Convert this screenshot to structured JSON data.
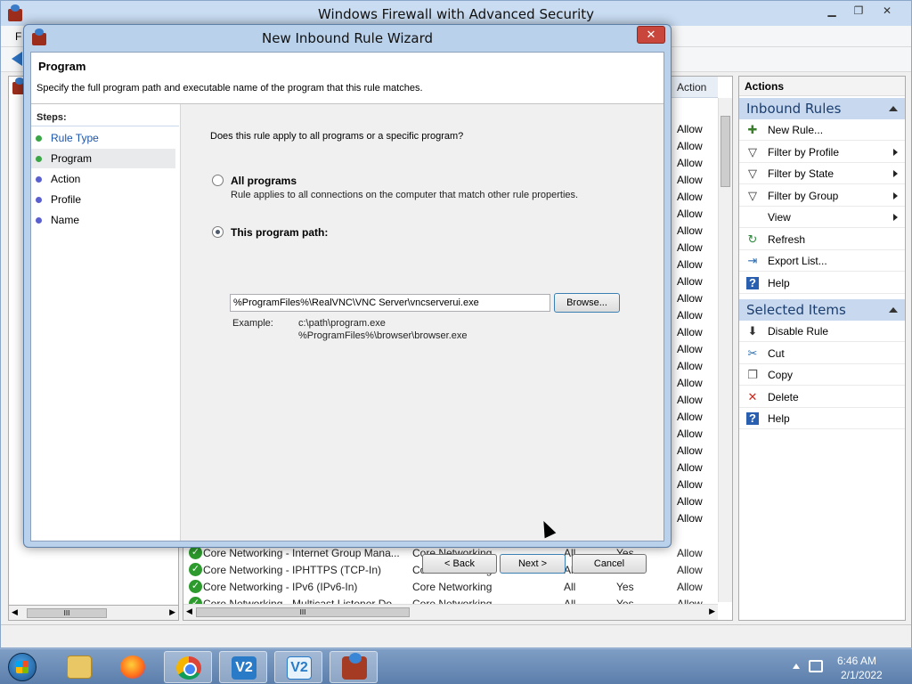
{
  "main": {
    "title": "Windows Firewall with Advanced Security",
    "menu_first_letter": "F",
    "list_headers": {
      "action": "Action"
    },
    "partial_action_values": [
      "Allow",
      "Allow",
      "Allow",
      "Allow",
      "Allow",
      "Allow",
      "Allow",
      "Allow",
      "Allow",
      "Allow",
      "Allow",
      "Allow",
      "Allow",
      "Allow",
      "Allow",
      "Allow",
      "Allow",
      "Allow",
      "Allow",
      "Allow",
      "Allow",
      "Allow",
      "Allow",
      "Allow"
    ],
    "visible_rows": [
      {
        "name": "Core Networking - Internet Group Mana...",
        "group": "Core Networking",
        "profile": "All",
        "enabled": "Yes",
        "action": "Allow"
      },
      {
        "name": "Core Networking - IPHTTPS (TCP-In)",
        "group": "Core Networking",
        "profile": "All",
        "enabled": "Yes",
        "action": "Allow"
      },
      {
        "name": "Core Networking - IPv6 (IPv6-In)",
        "group": "Core Networking",
        "profile": "All",
        "enabled": "Yes",
        "action": "Allow"
      },
      {
        "name": "Core Networking - Multicast Listener Do...",
        "group": "Core Networking",
        "profile": "All",
        "enabled": "Yes",
        "action": "Allow"
      }
    ],
    "tree_scroll_mark": "III",
    "list_scroll_mark": "III"
  },
  "actions": {
    "title": "Actions",
    "section1": "Inbound Rules",
    "section1_items": [
      {
        "label": "New Rule...",
        "icon": "new-rule-icon",
        "submenu": false
      },
      {
        "label": "Filter by Profile",
        "icon": "filter-icon",
        "submenu": true
      },
      {
        "label": "Filter by State",
        "icon": "filter-icon",
        "submenu": true
      },
      {
        "label": "Filter by Group",
        "icon": "filter-icon",
        "submenu": true
      },
      {
        "label": "View",
        "icon": "none",
        "submenu": true
      },
      {
        "label": "Refresh",
        "icon": "refresh-icon",
        "submenu": false
      },
      {
        "label": "Export List...",
        "icon": "export-icon",
        "submenu": false
      },
      {
        "label": "Help",
        "icon": "help-icon",
        "submenu": false
      }
    ],
    "section2": "Selected Items",
    "section2_items": [
      {
        "label": "Disable Rule",
        "icon": "disable-icon"
      },
      {
        "label": "Cut",
        "icon": "cut-icon"
      },
      {
        "label": "Copy",
        "icon": "copy-icon"
      },
      {
        "label": "Delete",
        "icon": "delete-icon"
      },
      {
        "label": "Help",
        "icon": "help-icon"
      }
    ]
  },
  "wizard": {
    "title": "New Inbound Rule Wizard",
    "close_label": "✕",
    "heading": "Program",
    "subheading": "Specify the full program path and executable name of the program that this rule matches.",
    "steps_label": "Steps:",
    "steps": [
      {
        "label": "Rule Type",
        "state": "done"
      },
      {
        "label": "Program",
        "state": "current"
      },
      {
        "label": "Action",
        "state": "todo"
      },
      {
        "label": "Profile",
        "state": "todo"
      },
      {
        "label": "Name",
        "state": "todo"
      }
    ],
    "question": "Does this rule apply to all programs or a specific program?",
    "option_all": {
      "label": "All programs",
      "description": "Rule applies to all connections on the computer that match other rule properties.",
      "selected": false
    },
    "option_path": {
      "label": "This program path:",
      "selected": true,
      "value": "%ProgramFiles%\\RealVNC\\VNC Server\\vncserverui.exe"
    },
    "browse_label": "Browse...",
    "example_label": "Example:",
    "example_line1": "c:\\path\\program.exe",
    "example_line2": "%ProgramFiles%\\browser\\browser.exe",
    "back_label": "< Back",
    "next_label": "Next >",
    "cancel_label": "Cancel"
  },
  "taskbar": {
    "apps": [
      "file-explorer",
      "firefox",
      "chrome",
      "vnc-viewer",
      "vnc-server",
      "windows-firewall"
    ],
    "vnc_glyph": "V2",
    "time": "6:46 AM",
    "date": "2/1/2022"
  },
  "colors": {
    "accent": "#c8d9ef",
    "step_done": "#3aa646",
    "step_todo": "#5a5fcf",
    "allow_check": "#2c9a2c"
  }
}
